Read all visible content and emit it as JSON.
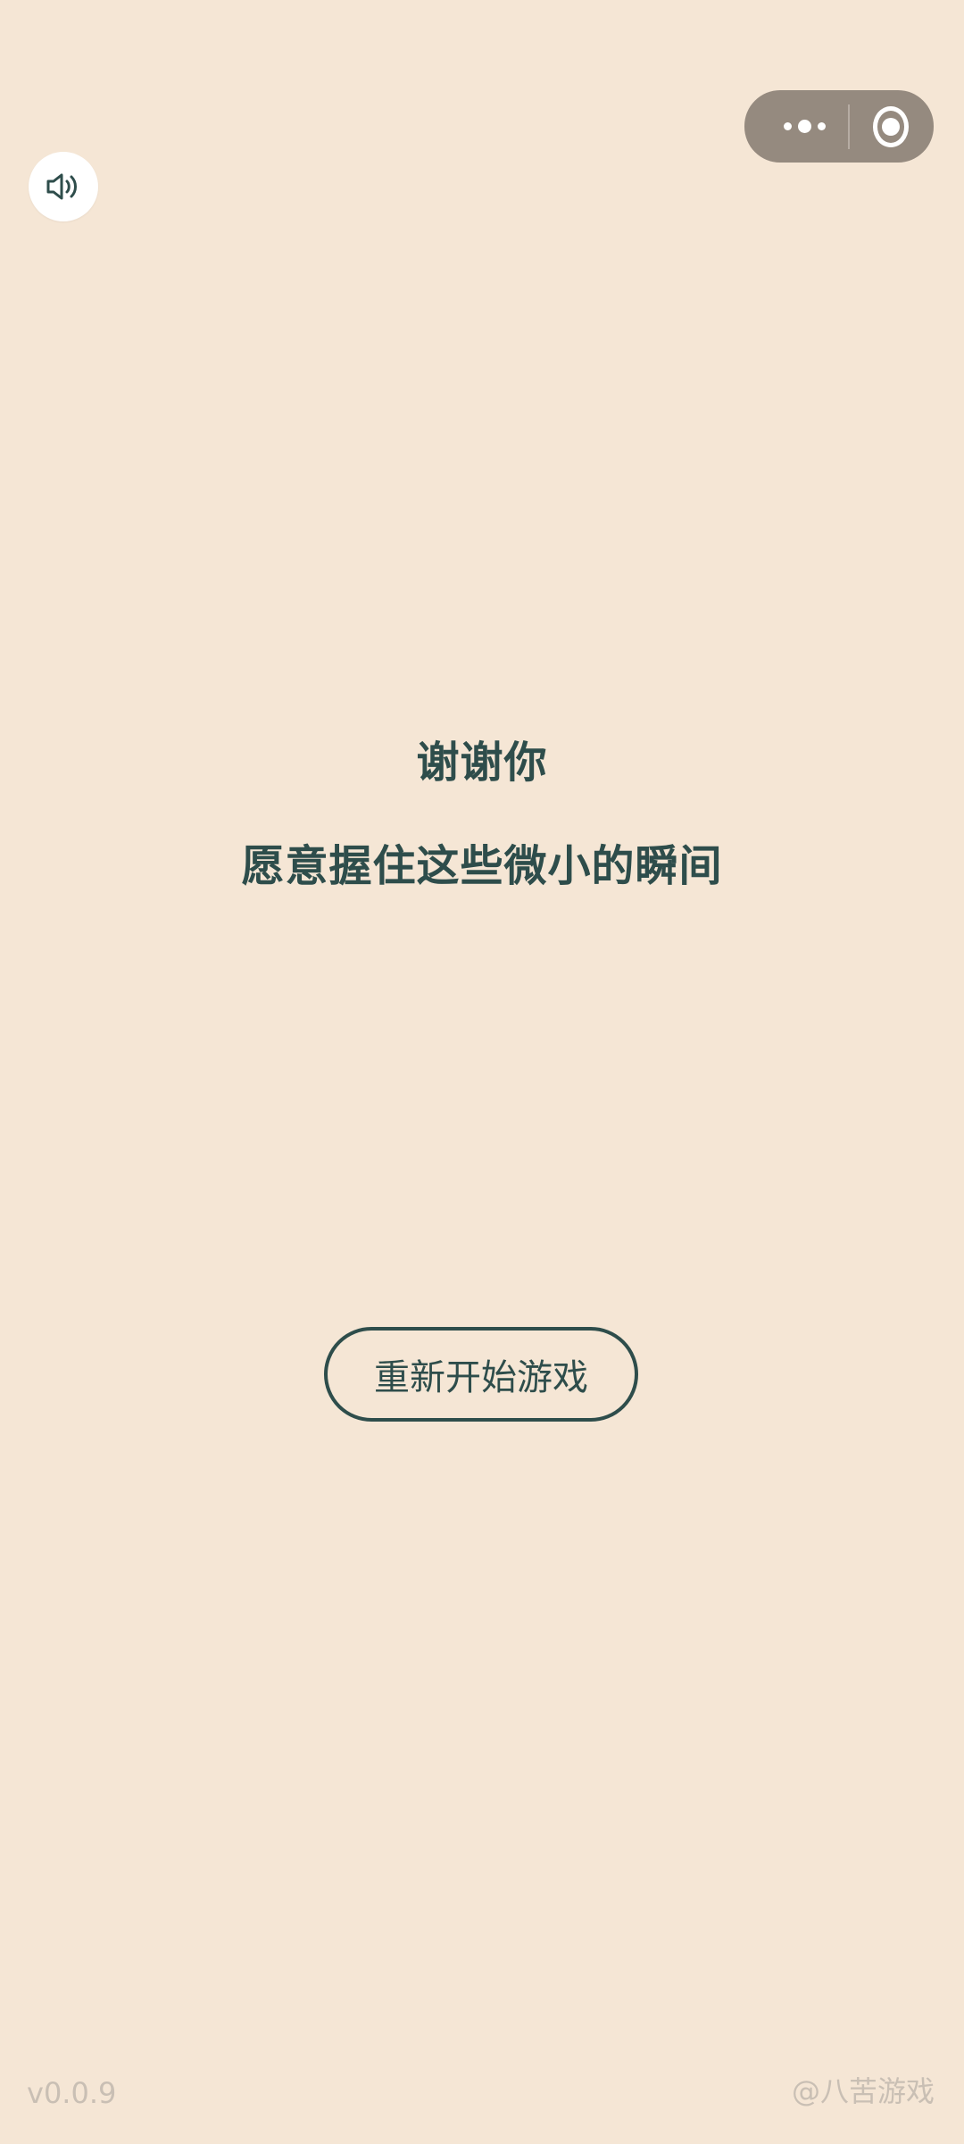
{
  "colors": {
    "background": "#F5E6D5",
    "text_primary": "#2E4D4B",
    "capsule_bg": "#958A7F",
    "footer_text": "#C9BFB4"
  },
  "icons": {
    "sound": "speaker-volume-icon",
    "capsule_more": "more-dots-icon",
    "capsule_close": "record-circle-icon"
  },
  "message": {
    "line1": "谢谢你",
    "line2": "愿意握住这些微小的瞬间"
  },
  "restart_button": {
    "label": "重新开始游戏"
  },
  "footer": {
    "version": "v0.0.9",
    "brand": "@八苦游戏"
  }
}
